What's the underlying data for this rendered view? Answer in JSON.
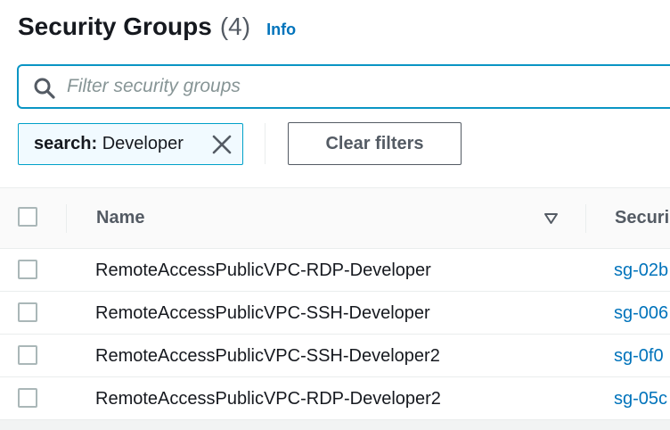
{
  "header": {
    "title": "Security Groups",
    "count": "(4)",
    "info_label": "Info"
  },
  "search": {
    "placeholder": "Filter security groups",
    "value": ""
  },
  "filter_token": {
    "key": "search:",
    "value": "Developer"
  },
  "clear_filters_label": "Clear filters",
  "table": {
    "columns": [
      "Name",
      "Securi"
    ],
    "rows": [
      {
        "name": "RemoteAccessPublicVPC-RDP-Developer",
        "id": "sg-02b"
      },
      {
        "name": "RemoteAccessPublicVPC-SSH-Developer",
        "id": "sg-006"
      },
      {
        "name": "RemoteAccessPublicVPC-SSH-Developer2",
        "id": "sg-0f0"
      },
      {
        "name": "RemoteAccessPublicVPC-RDP-Developer2",
        "id": "sg-05c"
      }
    ]
  },
  "colors": {
    "accent": "#0073bb",
    "focus_border": "#0a95c4",
    "token_bg": "#f1faff",
    "text": "#16191f"
  },
  "icons": [
    "search-icon",
    "close-icon",
    "sort-descending-icon",
    "checkbox"
  ]
}
